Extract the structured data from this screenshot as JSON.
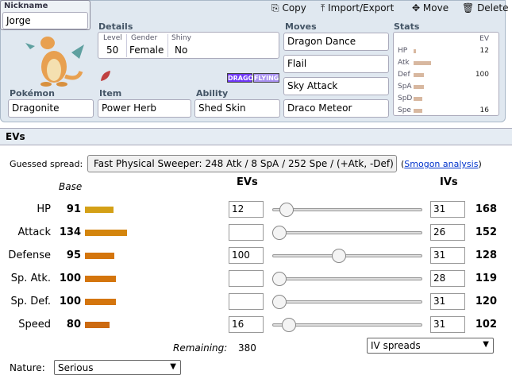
{
  "set": {
    "nickname_label": "Nickname",
    "nickname": "Jorge",
    "actions": {
      "copy": "Copy",
      "import_export": "Import/Export",
      "move": "Move",
      "delete": "Delete"
    },
    "details_label": "Details",
    "level_label": "Level",
    "level": "50",
    "gender_label": "Gender",
    "gender": "Female",
    "shiny_label": "Shiny",
    "shiny": "No",
    "types": [
      "DRAGON",
      "FLYING"
    ],
    "pokemon_label": "Pokémon",
    "pokemon": "Dragonite",
    "item_label": "Item",
    "item": "Power Herb",
    "ability_label": "Ability",
    "ability": "Shed Skin",
    "moves_label": "Moves",
    "moves": [
      "Dragon Dance",
      "Flail",
      "Sky Attack",
      "Draco Meteor"
    ],
    "stats_label": "Stats",
    "stats_ev_label": "EV",
    "stats_rows": [
      {
        "name": "HP",
        "ev": "12",
        "bar": 0.13
      },
      {
        "name": "Atk",
        "ev": "",
        "bar": 0.9
      },
      {
        "name": "Def",
        "ev": "100",
        "bar": 0.55
      },
      {
        "name": "SpA",
        "ev": "",
        "bar": 0.55
      },
      {
        "name": "SpD",
        "ev": "",
        "bar": 0.45
      },
      {
        "name": "Spe",
        "ev": "16",
        "bar": 0.45
      }
    ]
  },
  "evs": {
    "section_title": "EVs",
    "guessed_label": "Guessed spread:",
    "guessed_value": "Fast Physical Sweeper: 248 Atk / 8 SpA / 252 Spe / (+Atk, -Def)",
    "open_paren": "(",
    "smogon_link": "Smogon analysis",
    "close_paren": ")",
    "base_header": "Base",
    "evs_header": "EVs",
    "ivs_header": "IVs",
    "stats": [
      {
        "name": "HP",
        "base": "91",
        "ev": "12",
        "ev_value": 12,
        "iv": "31",
        "total": "168",
        "color": "#d4a017",
        "base_fraction": 0.36
      },
      {
        "name": "Attack",
        "base": "134",
        "ev": "",
        "ev_value": 0,
        "iv": "26",
        "total": "152",
        "color": "#d4850d",
        "base_fraction": 0.53
      },
      {
        "name": "Defense",
        "base": "95",
        "ev": "100",
        "ev_value": 100,
        "iv": "31",
        "total": "128",
        "color": "#d4750d",
        "base_fraction": 0.37
      },
      {
        "name": "Sp. Atk.",
        "base": "100",
        "ev": "",
        "ev_value": 0,
        "iv": "28",
        "total": "119",
        "color": "#d4750d",
        "base_fraction": 0.39
      },
      {
        "name": "Sp. Def.",
        "base": "100",
        "ev": "",
        "ev_value": 0,
        "iv": "31",
        "total": "120",
        "color": "#d4750d",
        "base_fraction": 0.39
      },
      {
        "name": "Speed",
        "base": "80",
        "ev": "16",
        "ev_value": 16,
        "iv": "31",
        "total": "102",
        "color": "#cc6a10",
        "base_fraction": 0.31
      }
    ],
    "ev_max": 252,
    "remaining_label": "Remaining:",
    "remaining_value": "380",
    "iv_spreads": "IV spreads",
    "nature_label": "Nature:",
    "nature": "Serious"
  },
  "colors": {
    "dragon": "#7038f8",
    "flying": "#a890f0",
    "link": "#0033cc"
  }
}
